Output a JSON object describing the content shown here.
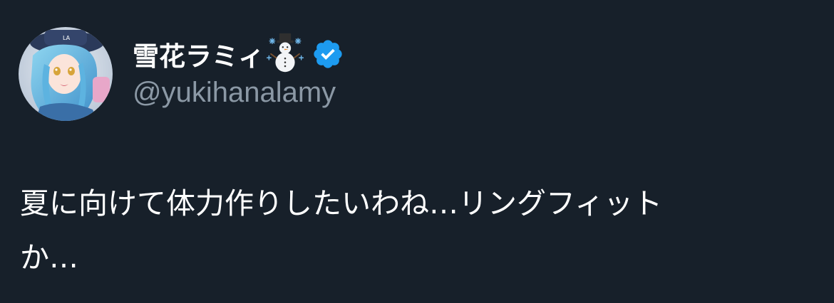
{
  "author": {
    "display_name": "雪花ラミィ",
    "handle": "@yukihanalamy",
    "name_emoji_icon": "snowman-icon",
    "verified_icon": "verified-badge-icon",
    "verified_color": "#1d9bf0"
  },
  "tweet": {
    "text_line_1": "夏に向けて体力作りしたいわね…リングフィット",
    "text_line_2": "か…"
  },
  "colors": {
    "background": "#17202a",
    "text_primary": "#ffffff",
    "text_secondary": "#8b98a5"
  }
}
